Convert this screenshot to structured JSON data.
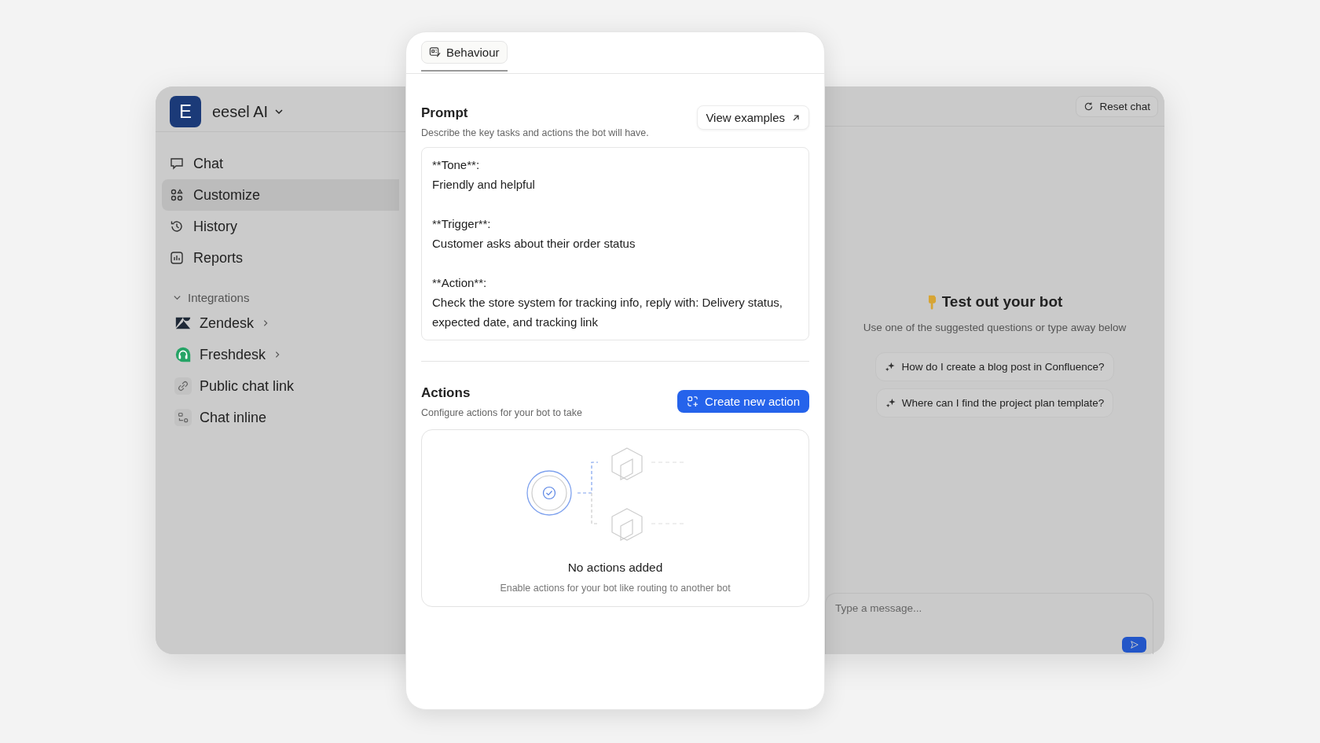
{
  "sidebar": {
    "workspace": {
      "initial": "E",
      "name": "eesel AI"
    },
    "nav": [
      {
        "label": "Chat",
        "selected": false
      },
      {
        "label": "Customize",
        "selected": true
      },
      {
        "label": "History",
        "selected": false
      },
      {
        "label": "Reports",
        "selected": false
      }
    ],
    "section": {
      "label": "Integrations",
      "expanded": true,
      "items": [
        {
          "label": "Zendesk",
          "has_submenu": true
        },
        {
          "label": "Freshdesk",
          "has_submenu": true
        },
        {
          "label": "Public chat link",
          "has_submenu": false
        },
        {
          "label": "Chat inline",
          "has_submenu": false
        }
      ]
    }
  },
  "editor": {
    "tabs": [
      {
        "label": "Behaviour",
        "selected": true
      }
    ],
    "prompt": {
      "title": "Prompt",
      "description": "Describe the key tasks and actions the bot will have.",
      "button": "View examples",
      "text": "**Tone**:\nFriendly and helpful\n\n**Trigger**:\nCustomer asks about their order status\n\n**Action**:\nCheck the store system for tracking info, reply with: Delivery status, expected date, and tracking link"
    },
    "actions": {
      "title": "Actions",
      "description": "Configure actions for your bot to take",
      "button": "Create new action",
      "empty_title": "No actions added",
      "empty_description": "Enable actions for your bot like routing to another bot"
    }
  },
  "chat": {
    "reset_button": "Reset chat",
    "title": "Test out your bot",
    "subtitle": "Use one of the suggested questions or type away below",
    "suggestions": [
      "How do I create a blog post in Confluence?",
      "Where can I find the project plan template?"
    ],
    "input": {
      "placeholder": "Type a message..."
    }
  }
}
